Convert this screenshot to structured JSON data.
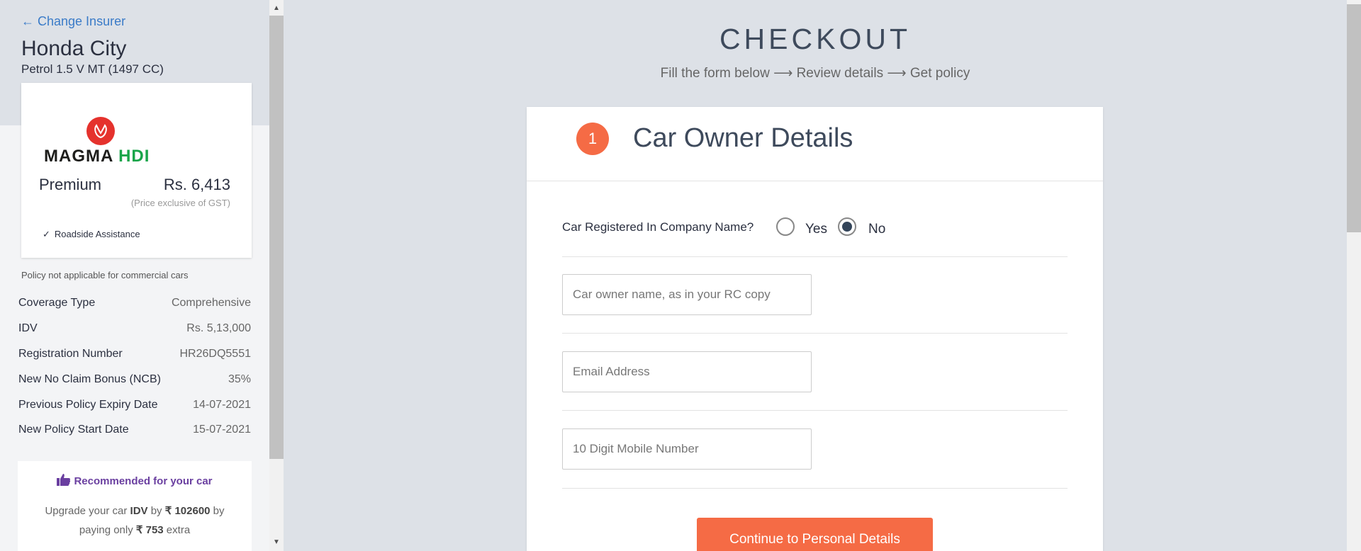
{
  "sidebar": {
    "change_insurer": "← Change Insurer",
    "car_name": "Honda City",
    "car_variant": "Petrol 1.5 V MT (1497 CC)",
    "insurer": {
      "logo_word1": "MAGMA ",
      "logo_word2": "HDI",
      "premium_label": "Premium",
      "premium_value": "Rs. 6,413",
      "gst_note": "(Price exclusive of GST)",
      "feature_check": "✓",
      "feature": "Roadside Assistance"
    },
    "policy_note": "Policy not applicable for commercial cars",
    "details": [
      {
        "label": "Coverage Type",
        "value": "Comprehensive"
      },
      {
        "label": "IDV",
        "value": "Rs. 5,13,000"
      },
      {
        "label": "Registration Number",
        "value": "HR26DQ5551"
      },
      {
        "label": "New No Claim Bonus (NCB)",
        "value": "35%"
      },
      {
        "label": "Previous Policy Expiry Date",
        "value": "14-07-2021"
      },
      {
        "label": "New Policy Start Date",
        "value": "15-07-2021"
      }
    ],
    "recommendation": {
      "title": "Recommended for your car",
      "upgrade_prefix": "Upgrade your car ",
      "idv_word": "IDV",
      "by_word": " by ",
      "rupee": "₹",
      "idv_amount": " 102600",
      "by_paying": " by paying only ",
      "extra_amount": " 753",
      "extra_suffix": " extra"
    }
  },
  "main": {
    "title": "CHECKOUT",
    "subtitle": "Fill the form below ⟶ Review details ⟶ Get policy",
    "step": {
      "number": "1",
      "title": "Car Owner Details"
    },
    "company_question": "Car Registered In Company Name?",
    "radio_yes": "Yes",
    "radio_no": "No",
    "owner_placeholder": "Car owner name, as in your RC copy",
    "email_placeholder": "Email Address",
    "mobile_placeholder": "10 Digit Mobile Number",
    "continue_label": "Continue to Personal Details"
  },
  "colors": {
    "accent": "#f56b45",
    "link": "#3a7bc8",
    "recommend": "#6a3fa0"
  }
}
